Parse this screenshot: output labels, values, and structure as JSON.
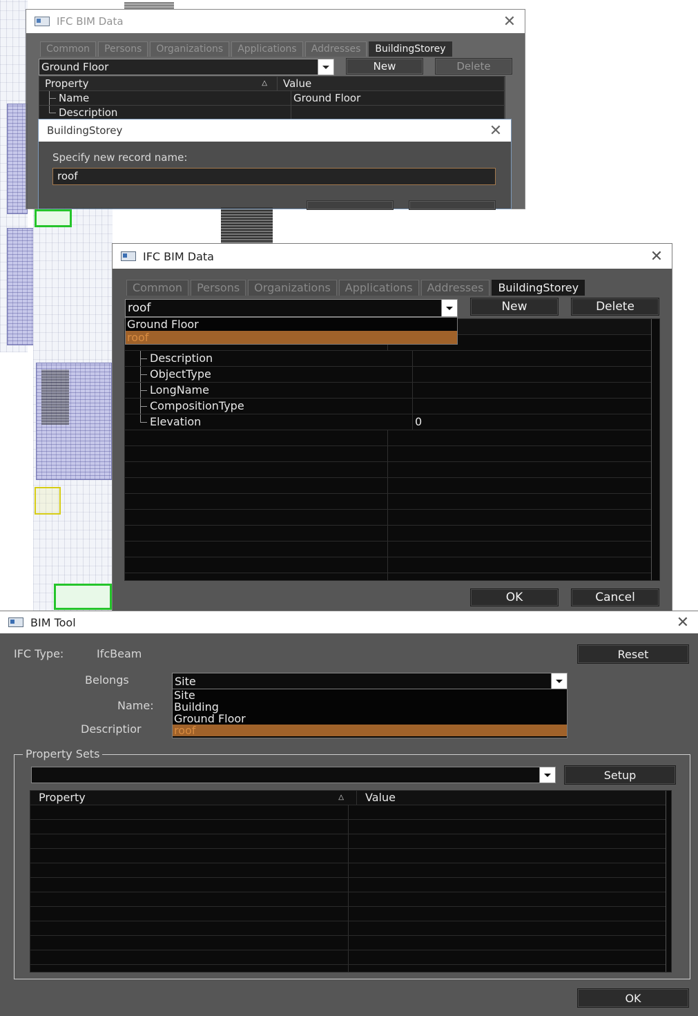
{
  "window_back": {
    "title": "IFC BIM Data",
    "tabs": [
      "Common",
      "Persons",
      "Organizations",
      "Applications",
      "Addresses",
      "BuildingStorey"
    ],
    "combo_value": "Ground Floor",
    "new_label": "New",
    "delete_label": "Delete",
    "grid_header": {
      "property": "Property",
      "value": "Value"
    },
    "rows": [
      {
        "property": "Name",
        "value": "Ground Floor"
      },
      {
        "property": "Description",
        "value": ""
      }
    ]
  },
  "dialog_new_record": {
    "title": "BuildingStorey",
    "prompt": "Specify new record name:",
    "input_value": "roof"
  },
  "window_front": {
    "title": "IFC BIM Data",
    "tabs": [
      "Common",
      "Persons",
      "Organizations",
      "Applications",
      "Addresses",
      "BuildingStorey"
    ],
    "combo_value": "roof",
    "combo_options": [
      "Ground Floor",
      "roof"
    ],
    "combo_selected_index": 1,
    "new_label": "New",
    "delete_label": "Delete",
    "rows": [
      {
        "property": "Description",
        "value": ""
      },
      {
        "property": "ObjectType",
        "value": ""
      },
      {
        "property": "LongName",
        "value": ""
      },
      {
        "property": "CompositionType",
        "value": ""
      },
      {
        "property": "Elevation",
        "value": "0"
      }
    ],
    "ok_label": "OK",
    "cancel_label": "Cancel"
  },
  "bim_tool": {
    "title": "BIM Tool",
    "ifc_type_label": "IFC Type:",
    "ifc_type_value": "IfcBeam",
    "reset_label": "Reset",
    "belongs_label": "Belongs",
    "belongs_value": "Site",
    "belongs_options": [
      "Site",
      "Building",
      "Ground Floor",
      "roof"
    ],
    "belongs_selected_index": 3,
    "name_label": "Name:",
    "description_label": "Descriptior",
    "property_sets_label": "Property Sets",
    "setup_label": "Setup",
    "grid_header": {
      "property": "Property",
      "value": "Value"
    },
    "ok_label": "OK"
  },
  "colors": {
    "window_bg": "#565656",
    "grid_bg": "#0b0b0b",
    "selection": "#a0622a",
    "selection_text": "#d88b3f",
    "cad_green": "#25c42b",
    "cad_purple": "#c7c8ea"
  }
}
